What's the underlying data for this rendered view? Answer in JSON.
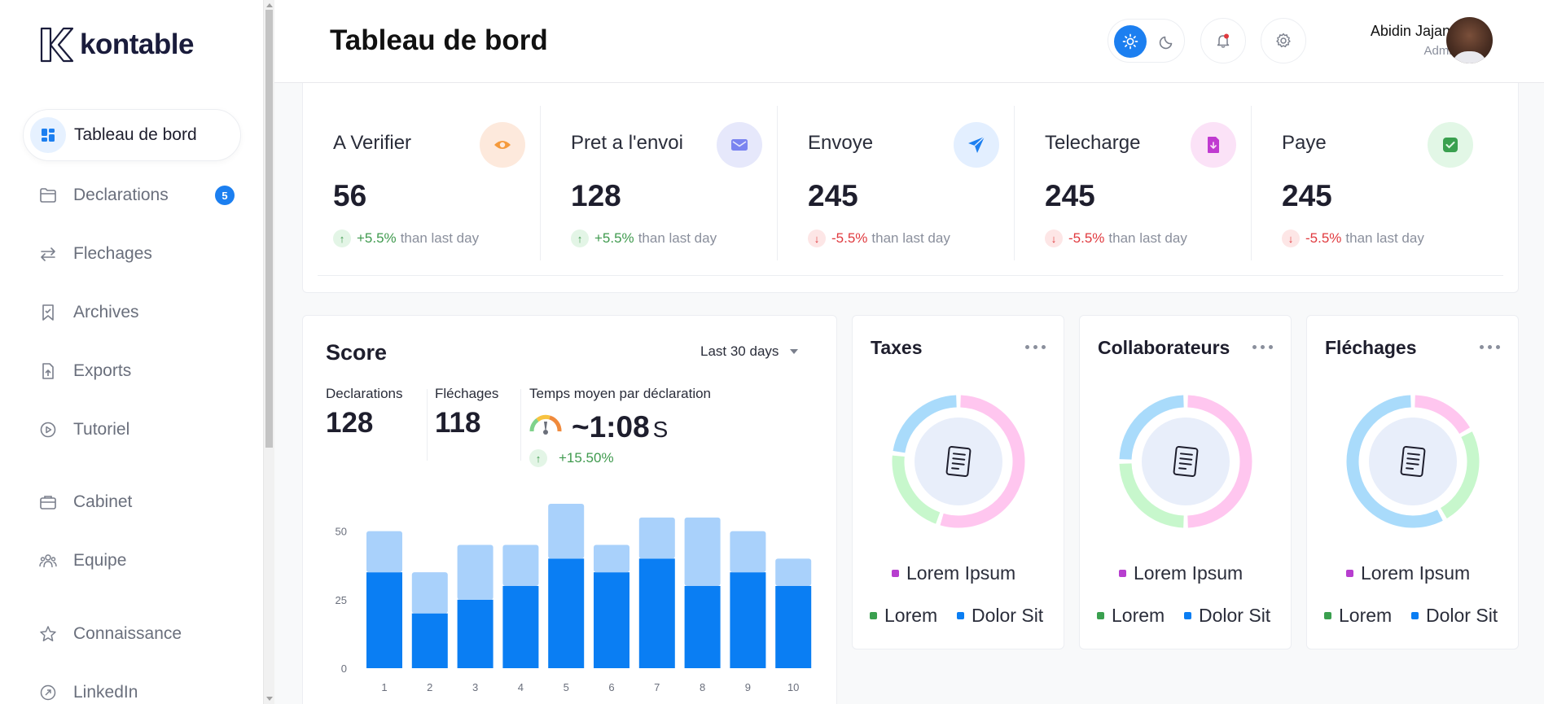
{
  "brand": {
    "name": "kontable"
  },
  "sidebar": {
    "items": [
      {
        "label": "Tableau de bord",
        "icon": "dashboard-icon",
        "active": true
      },
      {
        "label": "Declarations",
        "icon": "folder-icon",
        "badge": "5"
      },
      {
        "label": "Flechages",
        "icon": "swap-arrows-icon"
      },
      {
        "label": "Archives",
        "icon": "bookmark-icon"
      },
      {
        "label": "Exports",
        "icon": "file-export-icon"
      },
      {
        "label": "Tutoriel",
        "icon": "play-circle-icon"
      },
      {
        "label": "Cabinet",
        "icon": "briefcase-icon"
      },
      {
        "label": "Equipe",
        "icon": "team-icon"
      },
      {
        "label": "Connaissance",
        "icon": "star-icon"
      },
      {
        "label": "LinkedIn",
        "icon": "linkedin-icon"
      }
    ]
  },
  "header": {
    "title": "Tableau de bord",
    "theme": "light",
    "user": {
      "name": "Abidin Jajang",
      "role": "Admin"
    },
    "notifications_unread": true
  },
  "stats": [
    {
      "title": "A Verifier",
      "value": "56",
      "trend": "up",
      "pct": "+5.5%",
      "suffix": "than last day",
      "icon": "eye-icon",
      "icon_bg": "#fde9dc",
      "icon_color": "#f59a3c"
    },
    {
      "title": "Pret a l'envoi",
      "value": "128",
      "trend": "up",
      "pct": "+5.5%",
      "suffix": "than last day",
      "icon": "mail-icon",
      "icon_bg": "#e6e8fb",
      "icon_color": "#7a84f0"
    },
    {
      "title": "Envoye",
      "value": "245",
      "trend": "down",
      "pct": "-5.5%",
      "suffix": "than last day",
      "icon": "send-icon",
      "icon_bg": "#e3efff",
      "icon_color": "#1c7ff0"
    },
    {
      "title": "Telecharge",
      "value": "245",
      "trend": "down",
      "pct": "-5.5%",
      "suffix": "than last day",
      "icon": "download-file-icon",
      "icon_bg": "#fbe2f7",
      "icon_color": "#c03ad0"
    },
    {
      "title": "Paye",
      "value": "245",
      "trend": "down",
      "pct": "-5.5%",
      "suffix": "than last day",
      "icon": "check-icon",
      "icon_bg": "#e2f7e6",
      "icon_color": "#3aa04f"
    }
  ],
  "score": {
    "title": "Score",
    "range": "Last 30 days",
    "metrics": [
      {
        "label": "Declarations",
        "value": "128"
      },
      {
        "label": "Fléchages",
        "value": "118"
      }
    ],
    "time": {
      "label": "Temps moyen par déclaration",
      "value": "~1:08",
      "unit": "S",
      "trend": "+15.50%"
    }
  },
  "chart_data": {
    "type": "bar",
    "stacked": true,
    "categories": [
      "1",
      "2",
      "3",
      "4",
      "5",
      "6",
      "7",
      "8",
      "9",
      "10"
    ],
    "series": [
      {
        "values": [
          35,
          20,
          25,
          30,
          40,
          35,
          40,
          30,
          35,
          30
        ],
        "color": "#0a7ef3"
      },
      {
        "values": [
          15,
          15,
          20,
          15,
          20,
          10,
          15,
          25,
          15,
          10
        ],
        "color": "#a9d1fb"
      }
    ],
    "yticks": [
      0,
      25,
      50
    ],
    "ylim": [
      0,
      60
    ],
    "grid": false
  },
  "donuts": [
    {
      "title": "Taxes",
      "segments": [
        {
          "color": "#ffc6ef",
          "value": 55
        },
        {
          "color": "#c7f7cc",
          "value": 22
        },
        {
          "color": "#a9dbfb",
          "value": 23
        }
      ],
      "legend": {
        "top": "Lorem Ipsum",
        "left": "Lorem",
        "right": "Dolor Sit"
      },
      "icon": "document-icon"
    },
    {
      "title": "Collaborateurs",
      "segments": [
        {
          "color": "#ffc6ef",
          "value": 50
        },
        {
          "color": "#c7f7cc",
          "value": 25
        },
        {
          "color": "#a9dbfb",
          "value": 25
        }
      ],
      "legend": {
        "top": "Lorem Ipsum",
        "left": "Lorem",
        "right": "Dolor Sit"
      },
      "icon": "document-icon"
    },
    {
      "title": "Fléchages",
      "segments": [
        {
          "color": "#ffc6ef",
          "value": 17
        },
        {
          "color": "#c7f7cc",
          "value": 25
        },
        {
          "color": "#a9dbfb",
          "value": 58
        }
      ],
      "legend": {
        "top": "Lorem Ipsum",
        "left": "Lorem",
        "right": "Dolor Sit"
      },
      "icon": "document-icon"
    }
  ],
  "legend_colors": {
    "top": "#b73ecf",
    "left": "#3aa04f",
    "right": "#0a7ef3"
  }
}
